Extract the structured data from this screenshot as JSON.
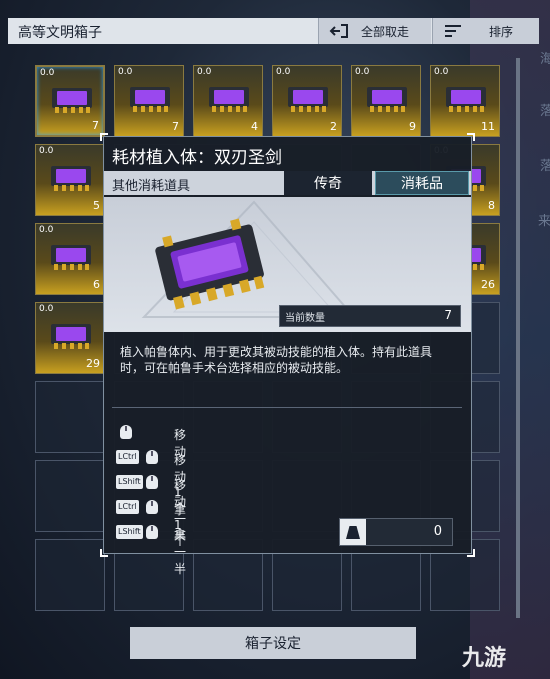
{
  "header": {
    "title": "高等文明箱子",
    "take_all": "全部取走",
    "sort": "排序"
  },
  "slots": [
    {
      "val": "0.0",
      "count": "7",
      "filled": true,
      "selected": true
    },
    {
      "val": "0.0",
      "count": "7",
      "filled": true
    },
    {
      "val": "0.0",
      "count": "4",
      "filled": true
    },
    {
      "val": "0.0",
      "count": "2",
      "filled": true
    },
    {
      "val": "0.0",
      "count": "9",
      "filled": true
    },
    {
      "val": "0.0",
      "count": "11",
      "filled": true
    },
    {
      "val": "0.0",
      "count": "5",
      "filled": true
    },
    {
      "val": "0.0",
      "count": "8",
      "filled": true
    },
    {
      "val": "0.0",
      "count": "6",
      "filled": true
    },
    {
      "val": "0.0",
      "count": "26",
      "filled": true
    },
    {
      "val": "0.0",
      "count": "29",
      "filled": true
    }
  ],
  "tooltip": {
    "title": "耗材植入体：双刃圣剑",
    "category": "其他消耗道具",
    "rarity": "传奇",
    "type": "消耗品",
    "quantity_label": "当前数量",
    "quantity": "7",
    "description": "植入帕鲁体内、用于更改其被动技能的植入体。持有此道具时，可在帕鲁手术台选择相应的被动技能。",
    "actions": [
      {
        "keys": [],
        "label": "移动"
      },
      {
        "keys": [
          "LCtrl"
        ],
        "label": "移动1个"
      },
      {
        "keys": [
          "LShift"
        ],
        "label": "移动一半"
      },
      {
        "keys": [
          "LCtrl"
        ],
        "label": "拿1个"
      },
      {
        "keys": [
          "LShift"
        ],
        "label": "拿一半"
      }
    ],
    "weight": "0"
  },
  "footer": {
    "settings": "箱子设定"
  },
  "bg_text": [
    "海",
    "落",
    "落",
    "来"
  ],
  "watermark": "九游"
}
